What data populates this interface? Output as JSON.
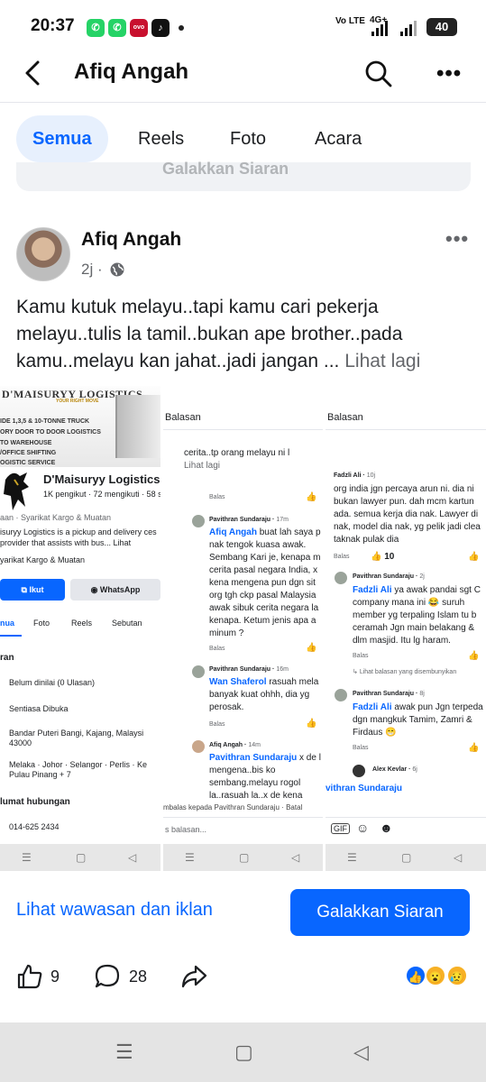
{
  "status": {
    "time": "20:37",
    "network": "Vo LTE",
    "network2": "4G+",
    "battery": "40",
    "app_icons": [
      "whatsapp-icon",
      "whatsapp-icon",
      "ovo-icon",
      "tiktok-icon"
    ]
  },
  "header": {
    "title": "Afiq Angah"
  },
  "tabs": [
    "Semua",
    "Reels",
    "Foto",
    "Acara"
  ],
  "ghost_text": "Galakkan Siaran",
  "post": {
    "author": "Afiq Angah",
    "time": "2j",
    "text": "Kamu kutuk melayu..tapi kamu cari pekerja melayu..tulis la tamil..bukan ape brother..pada kamu..melayu kan jahat..jadi jangan ...",
    "see_more": "Lihat lagi"
  },
  "panel1": {
    "cover_title": "D'MAISURYY LOGISTICS",
    "cover_sub": "YOUR RIGHT MOVE",
    "cover_lines": [
      "IDE 1,3,5 & 10-TONNE TRUCK",
      "ORY DOOR TO DOOR LOGISTICS",
      "TO WAREHOUSE",
      "/OFFICE SHIFTING",
      "OGISTIC SERVICE"
    ],
    "page_name": "D'Maisuryy Logistics",
    "stats": "1K pengikut · 72 mengikuti · 58 s",
    "category": "aan · Syarikat Kargo & Muatan",
    "desc": "isuryy Logistics is a pickup and delivery ces provider that assists with bus... Lihat",
    "category2": "yarikat Kargo & Muatan",
    "follow": "Ikut",
    "whatsapp": "WhatsApp",
    "tabs": [
      "nua",
      "Foto",
      "Reels",
      "Sebutan"
    ],
    "section": "ran",
    "info": [
      "Belum dinilai (0 Ulasan)",
      "Sentiasa Dibuka",
      "Bandar Puteri Bangi, Kajang, Malaysi 43000",
      "Melaka · Johor · Selangor · Perlis · Ke Pulau Pinang + 7"
    ],
    "contact_title": "lumat hubungan",
    "phone": "014-625 2434"
  },
  "panel2": {
    "title": "Balasan",
    "top_text": "cerita..tp orang melayu ni l",
    "top_more": "Lihat lagi",
    "comments": [
      {
        "name": "Pavithran Sundaraju",
        "time": "17m",
        "mention": "Afiq Angah",
        "text": "buat lah saya p nak tengok kuasa awak. Sembang Kari je, kenapa m cerita pasal negara India, x kena mengena pun dgn sit org tgh ckp pasal Malaysia awak sibuk cerita negara la kenapa. Ketum jenis apa a minum ?"
      },
      {
        "name": "Pavithran Sundaraju",
        "time": "16m",
        "mention": "Wan Shaferol",
        "text": "rasuah mela banyak kuat ohhh, dia yg perosak."
      },
      {
        "name": "Afiq Angah",
        "time": "14m",
        "mention": "Pavithran Sundaraju",
        "text": "x de l mengena..bis ko sembang.melayu rogol la..rasuah la..x de kena"
      }
    ],
    "balas": "Balas",
    "reply_to": "mbalas kepada Pavithran Sundaraju · Batal",
    "input_placeholder": "s balasan..."
  },
  "panel3": {
    "title": "Balasan",
    "comments": [
      {
        "name": "Fadzli Ali",
        "time": "10j",
        "mention": "",
        "text": "org india jgn percaya arun ni. dia ni bukan lawyer pun. dah mcm kartun ada. semua kerja dia nak. Lawyer di nak, model dia nak, yg pelik jadi clea taknak pulak dia",
        "likes": "10"
      },
      {
        "name": "Pavithran Sundaraju",
        "time": "2j",
        "mention": "Fadzli Ali",
        "text": "ya awak pandai sgt C company mana ini 😂 suruh member yg terpaling Islam tu b ceramah Jgn main belakang & dlm masjid. Itu lg haram."
      },
      {
        "name": "Pavithran Sundaraju",
        "time": "8j",
        "mention": "Fadzli Ali",
        "text": "awak pun Jgn terpeda dgn mangkuk Tamim, Zamri & Firdaus 😁"
      },
      {
        "name": "Alex Kevlar",
        "time": "6j",
        "mention": "",
        "text": ""
      }
    ],
    "hidden_replies": "Lihat balasan yang disembunyikan",
    "balas": "Balas",
    "reply_name": "vithran Sundaraju",
    "reply_to": "mbalas kepada Pavithran Sundaraju · Batal"
  },
  "actions": {
    "insights": "Lihat wawasan dan iklan",
    "promote": "Galakkan Siaran",
    "likes": "9",
    "comments": "28"
  }
}
